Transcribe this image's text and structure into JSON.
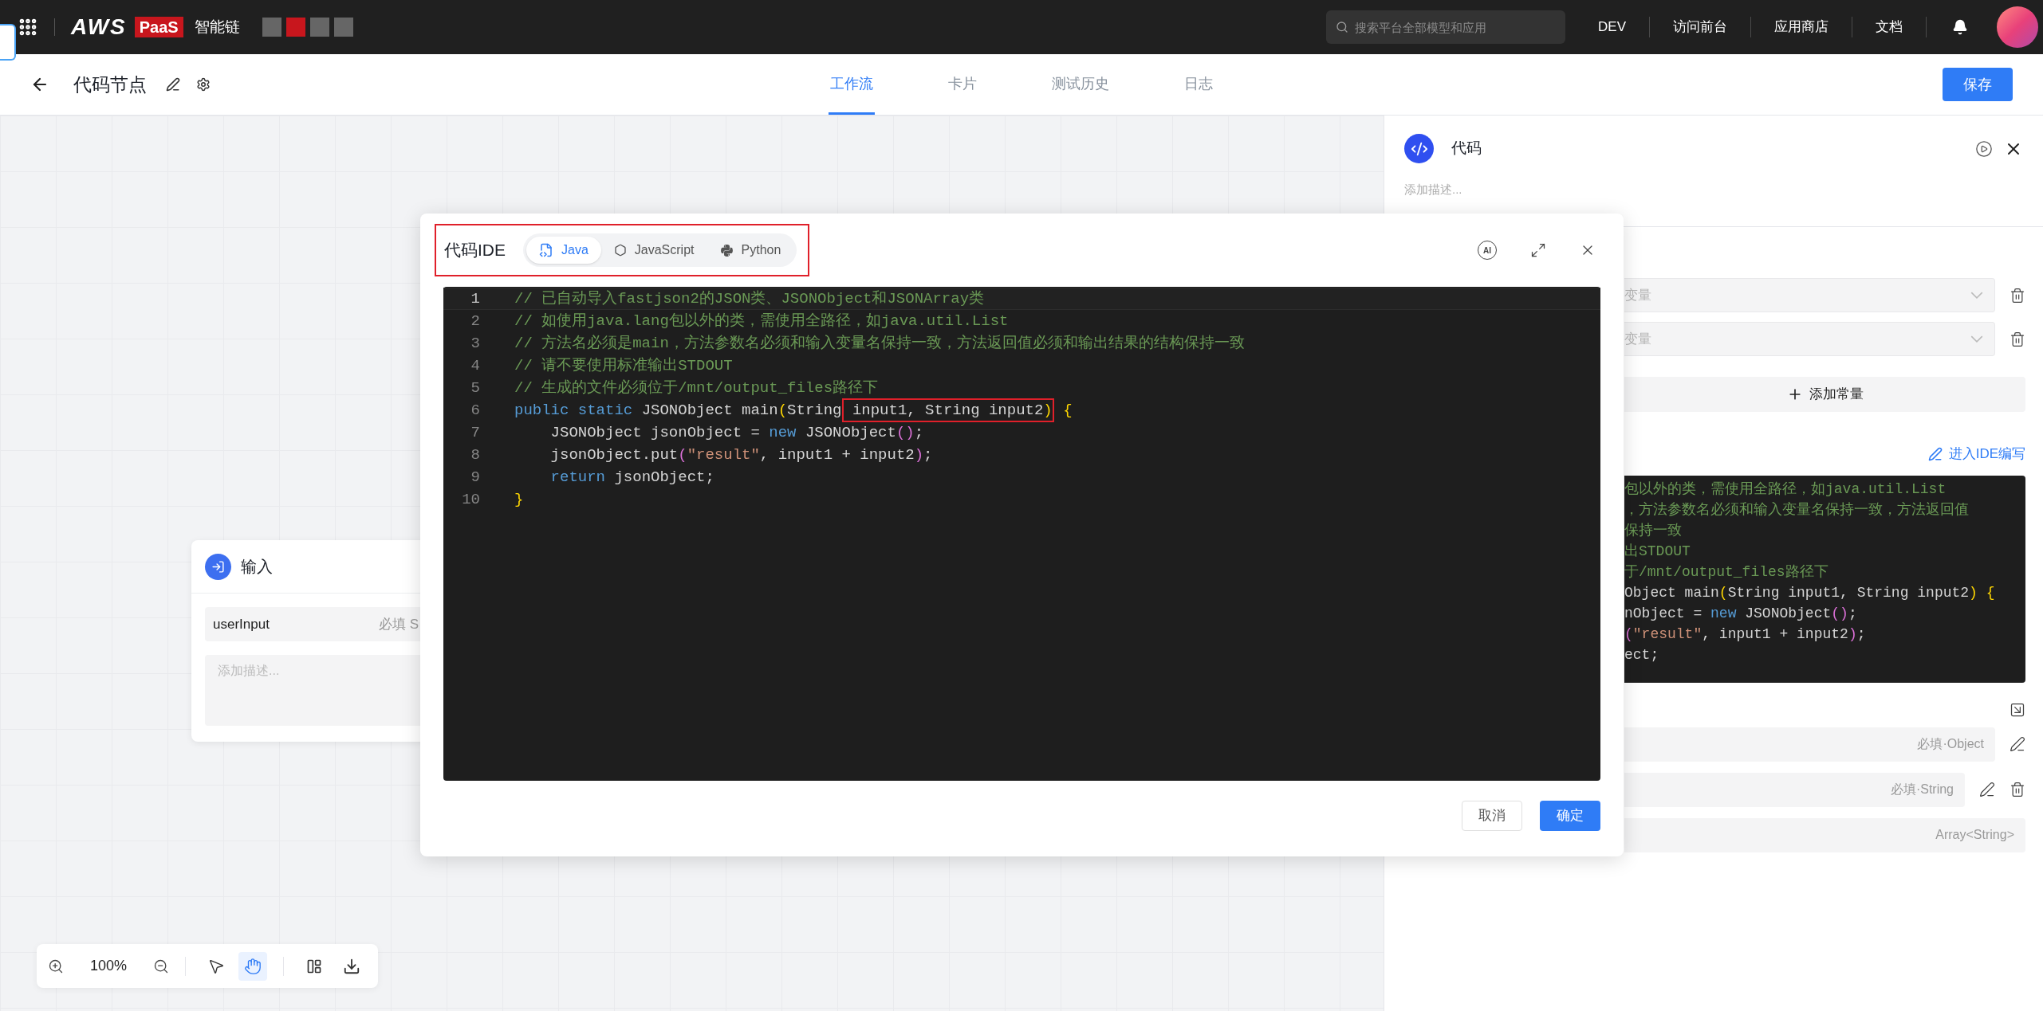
{
  "topbar": {
    "logo": "AWS",
    "logo_badge": "PaaS",
    "product": "智能链",
    "swatches": [
      {
        "color": "#666666"
      },
      {
        "color": "#c8161d"
      },
      {
        "color": "#666666"
      },
      {
        "color": "#666666"
      }
    ],
    "search": {
      "placeholder": "搜索平台全部模型和应用"
    },
    "links": [
      "DEV",
      "访问前台",
      "应用商店",
      "文档"
    ]
  },
  "header": {
    "title": "代码节点",
    "tabs": [
      {
        "label": "工作流",
        "selected": true
      },
      {
        "label": "卡片",
        "selected": false
      },
      {
        "label": "测试历史",
        "selected": false
      },
      {
        "label": "日志",
        "selected": false
      }
    ],
    "save": "保存"
  },
  "canvas": {
    "node": {
      "title": "输入",
      "field": {
        "name": "userInput",
        "hint": "必填 S"
      },
      "description": {
        "placeholder": "添加描述..."
      }
    },
    "toolbar": {
      "zoom": "100%",
      "tools": [
        {
          "kind": "pointer",
          "selected": false
        },
        {
          "kind": "hand",
          "selected": true
        }
      ]
    }
  },
  "panel": {
    "title": "代码",
    "description": {
      "placeholder": "添加描述..."
    },
    "inputs": [
      {
        "placeholder": "变量"
      },
      {
        "placeholder": "变量"
      }
    ],
    "add_constant": "添加常量",
    "ide_link": "进入IDE编写",
    "code_lines": [
      [
        {
          "kind": "comment",
          "text": "包以外的类，需使用全路径，如java.util.List"
        }
      ],
      [
        {
          "kind": "comment",
          "text": "，方法参数名必须和输入变量名保持一致，方法返回值"
        }
      ],
      [
        {
          "kind": "comment",
          "text": "保持一致"
        }
      ],
      [
        {
          "kind": "comment",
          "text": "出STDOUT"
        }
      ],
      [
        {
          "kind": "comment",
          "text": "于/mnt/output_files路径下"
        }
      ],
      [
        {
          "kind": "plain",
          "text": "Object main"
        },
        {
          "kind": "paren",
          "text": "("
        },
        {
          "kind": "plain",
          "text": "String input1, String input2"
        },
        {
          "kind": "paren",
          "text": ") {"
        }
      ],
      [
        {
          "kind": "plain",
          "text": "nObject = "
        },
        {
          "kind": "keyword",
          "text": "new"
        },
        {
          "kind": "plain",
          "text": " JSONObject"
        },
        {
          "kind": "paren2",
          "text": "()"
        },
        {
          "kind": "plain",
          "text": ";"
        }
      ],
      [
        {
          "kind": "paren2",
          "text": "("
        },
        {
          "kind": "string",
          "text": "\"result\""
        },
        {
          "kind": "plain",
          "text": ", input1 + input2"
        },
        {
          "kind": "paren2",
          "text": ")"
        },
        {
          "kind": "plain",
          "text": ";"
        }
      ],
      [
        {
          "kind": "plain",
          "text": "ect;"
        }
      ]
    ],
    "outputs": [
      {
        "type": "必填·Object",
        "editable": true,
        "deletable": false
      },
      {
        "type": "必填·String",
        "editable": true,
        "deletable": true
      },
      {
        "type": "Array<String>",
        "editable": false,
        "deletable": false
      }
    ]
  },
  "modal": {
    "title": "代码IDE",
    "annotated": true,
    "languages": [
      {
        "kind": "java",
        "label": "Java",
        "selected": true
      },
      {
        "kind": "javascript",
        "label": "JavaScript",
        "selected": false
      },
      {
        "kind": "python",
        "label": "Python",
        "selected": false
      }
    ],
    "ai": "AI",
    "lines": [
      {
        "number": "1",
        "active": true,
        "tokens": [
          {
            "kind": "comment",
            "text": "// 已自动导入fastjson2的JSON类、JSONObject和JSONArray类"
          }
        ]
      },
      {
        "number": "2",
        "active": false,
        "tokens": [
          {
            "kind": "comment",
            "text": "// 如使用java.lang包以外的类，需使用全路径，如java.util.List"
          }
        ]
      },
      {
        "number": "3",
        "active": false,
        "tokens": [
          {
            "kind": "comment",
            "text": "// 方法名必须是main，方法参数名必须和输入变量名保持一致，方法返回值必须和输出结果的结构保持一致"
          }
        ]
      },
      {
        "number": "4",
        "active": false,
        "tokens": [
          {
            "kind": "comment",
            "text": "// 请不要使用标准输出STDOUT"
          }
        ]
      },
      {
        "number": "5",
        "active": false,
        "tokens": [
          {
            "kind": "comment",
            "text": "// 生成的文件必须位于/mnt/output_files路径下"
          }
        ]
      },
      {
        "number": "6",
        "active": false,
        "tokens": [
          {
            "kind": "keyword",
            "text": "public static"
          },
          {
            "kind": "plain",
            "text": " JSONObject main"
          },
          {
            "kind": "paren",
            "text": "("
          },
          {
            "kind": "plain",
            "text": "String"
          },
          {
            "kind": "plain",
            "text": " input1, String input2",
            "boxed": true
          },
          {
            "kind": "paren",
            "text": ")",
            "boxed": true
          },
          {
            "kind": "paren",
            "text": " {"
          }
        ]
      },
      {
        "number": "7",
        "active": false,
        "tokens": [
          {
            "kind": "plain",
            "text": "    JSONObject jsonObject = "
          },
          {
            "kind": "keyword",
            "text": "new"
          },
          {
            "kind": "plain",
            "text": " JSONObject"
          },
          {
            "kind": "paren2",
            "text": "()"
          },
          {
            "kind": "plain",
            "text": ";"
          }
        ]
      },
      {
        "number": "8",
        "active": false,
        "tokens": [
          {
            "kind": "plain",
            "text": "    jsonObject.put"
          },
          {
            "kind": "paren2",
            "text": "("
          },
          {
            "kind": "string",
            "text": "\"result\""
          },
          {
            "kind": "plain",
            "text": ", input1 + input2"
          },
          {
            "kind": "paren2",
            "text": ")"
          },
          {
            "kind": "plain",
            "text": ";"
          }
        ]
      },
      {
        "number": "9",
        "active": false,
        "tokens": [
          {
            "kind": "keyword",
            "text": "    return"
          },
          {
            "kind": "plain",
            "text": " jsonObject;"
          }
        ]
      },
      {
        "number": "10",
        "active": false,
        "tokens": [
          {
            "kind": "paren",
            "text": "}"
          }
        ]
      }
    ],
    "cancel": "取消",
    "confirm": "确定"
  }
}
